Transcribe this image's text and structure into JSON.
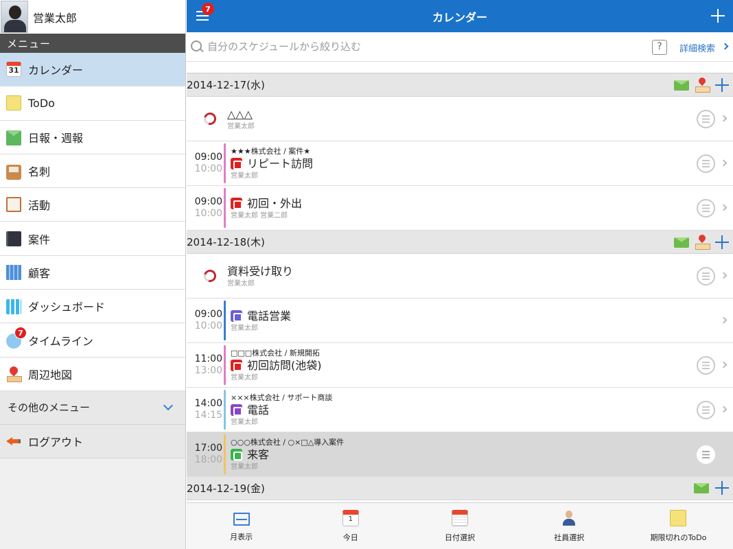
{
  "user": {
    "name": "営業太郎"
  },
  "sidebar": {
    "caption": "メニュー",
    "items": [
      {
        "label": "カレンダー",
        "icon": "calendar-icon",
        "icon_text": "31",
        "active": true
      },
      {
        "label": "ToDo",
        "icon": "todo-note-icon"
      },
      {
        "label": "日報・週報",
        "icon": "daily-report-icon"
      },
      {
        "label": "名刺",
        "icon": "business-card-icon"
      },
      {
        "label": "活動",
        "icon": "clipboard-icon"
      },
      {
        "label": "案件",
        "icon": "binder-icon"
      },
      {
        "label": "顧客",
        "icon": "building-icon"
      },
      {
        "label": "ダッシュボード",
        "icon": "dashboard-icon"
      },
      {
        "label": "タイムライン",
        "icon": "speech-bubble-icon",
        "badge": "7"
      },
      {
        "label": "周辺地図",
        "icon": "map-pin-icon"
      }
    ],
    "other_menu": "その他のメニュー",
    "logout": "ログアウト"
  },
  "navbar": {
    "title": "カレンダー",
    "badge": "7",
    "accent": "#1a73c8"
  },
  "search": {
    "placeholder": "自分のスケジュールから絞り込む",
    "help": "?",
    "advanced": "詳細検索"
  },
  "days": [
    {
      "date": "2014-12-17(水)",
      "events": [
        {
          "allday": true,
          "title": "△△△",
          "who": "営業太郎"
        },
        {
          "start": "09:00",
          "end": "10:00",
          "sub": "★★★株式会社 / 案件★",
          "title": "リピート訪問",
          "who": "営業太郎",
          "bar": "#e07ec8",
          "type_color": "#e02020"
        },
        {
          "start": "09:00",
          "end": "10:00",
          "title": "初回・外出",
          "who": "営業太郎 営業二郎",
          "bar": "#e07ec8",
          "type_color": "#e02020"
        }
      ]
    },
    {
      "date": "2014-12-18(木)",
      "events": [
        {
          "allday": true,
          "title": "資料受け取り",
          "who": "営業太郎"
        },
        {
          "start": "09:00",
          "end": "10:00",
          "title": "電話営業",
          "who": "営業太郎",
          "bar": "#3a7bd5",
          "type_color": "#6b5fd6"
        },
        {
          "start": "11:00",
          "end": "13:00",
          "sub": "□□□株式会社 / 新規開拓",
          "title": "初回訪問(池袋)",
          "who": "営業太郎",
          "bar": "#e07ec8",
          "type_color": "#e02020"
        },
        {
          "start": "14:00",
          "end": "14:15",
          "sub": "×××株式会社 / サポート商談",
          "title": "電話",
          "who": "営業太郎",
          "bar": "#86c3ea",
          "type_color": "#8a44c8"
        },
        {
          "start": "17:00",
          "end": "18:00",
          "sub": "○○○株式会社 / ○×□△導入案件",
          "title": "来客",
          "who": "営業太郎",
          "bar": "#f0c560",
          "type_color": "#39b54a",
          "highlighted": true
        }
      ]
    },
    {
      "date": "2014-12-19(金)",
      "events": []
    }
  ],
  "tabs": [
    {
      "label": "月表示",
      "icon": "month-view-icon"
    },
    {
      "label": "今日",
      "icon": "today-calendar-icon",
      "icon_text": "1"
    },
    {
      "label": "日付選択",
      "icon": "date-picker-icon"
    },
    {
      "label": "社員選択",
      "icon": "employee-icon"
    },
    {
      "label": "期限切れのToDo",
      "icon": "overdue-todo-icon"
    }
  ]
}
